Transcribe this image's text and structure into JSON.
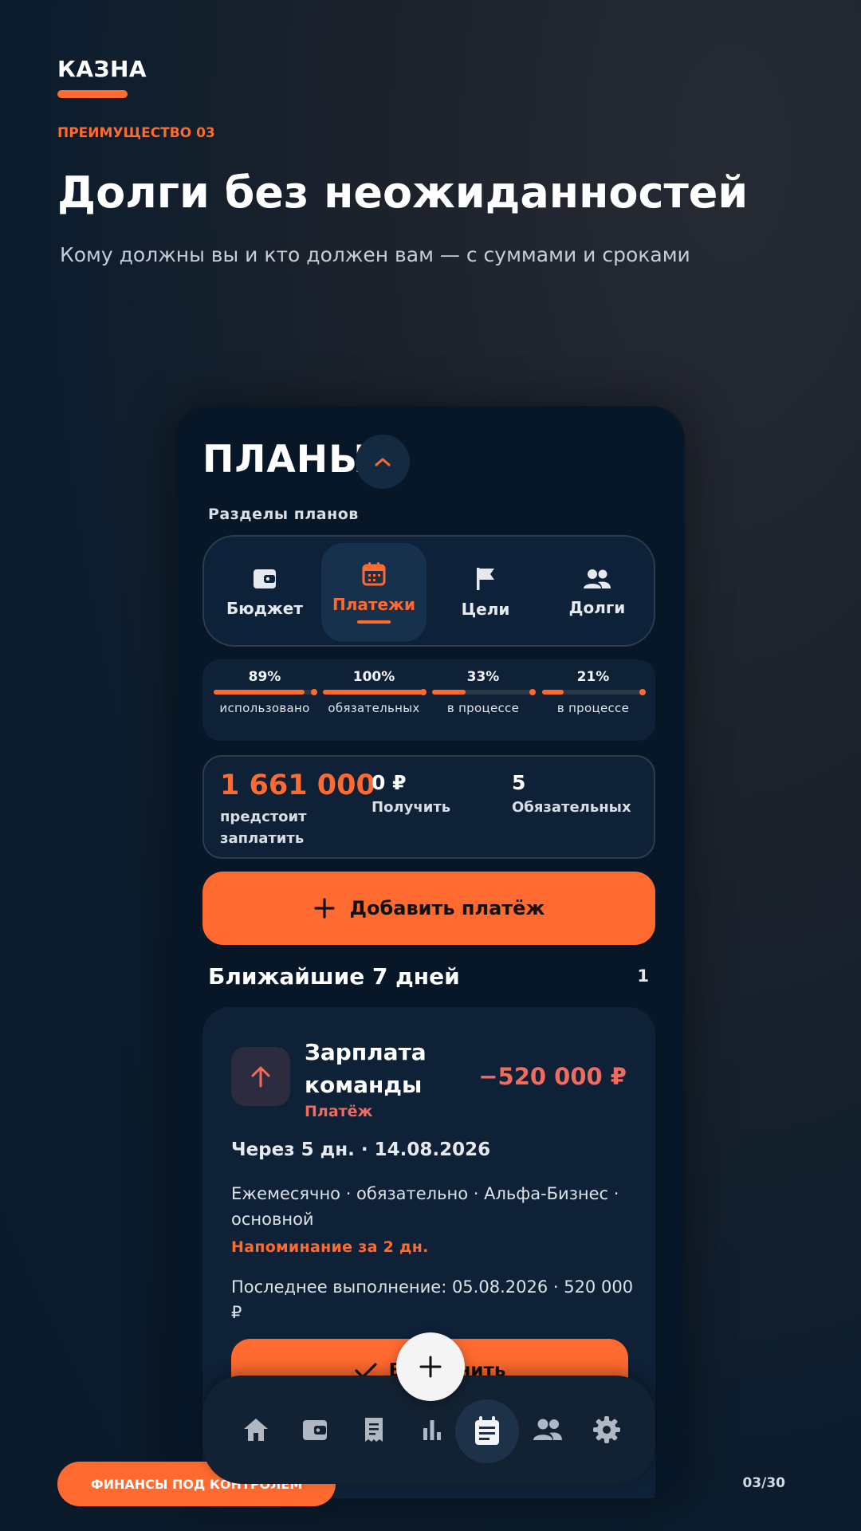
{
  "brand": "КАЗНА",
  "kicker": "ПРЕИМУЩЕСТВО 03",
  "headline": "Долги без неожиданностей",
  "subheadline": "Кому должны вы и кто должен вам — с суммами и сроками",
  "app": {
    "title": "ПЛАНЫ",
    "sections_label": "Разделы планов",
    "tabs": [
      {
        "label": "Бюджет",
        "icon": "wallet-icon"
      },
      {
        "label": "Платежи",
        "icon": "calendar-icon",
        "active": true
      },
      {
        "label": "Цели",
        "icon": "flag-icon"
      },
      {
        "label": "Долги",
        "icon": "people-icon"
      }
    ],
    "progress": [
      {
        "percent": "89%",
        "value": 0.89,
        "caption": "использовано"
      },
      {
        "percent": "100%",
        "value": 1.0,
        "caption": "обязательных"
      },
      {
        "percent": "33%",
        "value": 0.33,
        "caption": "в процессе"
      },
      {
        "percent": "21%",
        "value": 0.21,
        "caption": "в процессе"
      }
    ],
    "stats": {
      "main_value": "1 661 000",
      "main_caption": "предстоит заплатить",
      "receive_value": "0 ₽",
      "receive_caption": "Получить",
      "mandatory_value": "5",
      "mandatory_caption": "Обязательных"
    },
    "add_button": "Добавить платёж",
    "upcoming": {
      "title": "Ближайшие 7 дней",
      "count": "1"
    },
    "payment": {
      "title": "Зарплата команды",
      "kind": "Платёж",
      "amount": "−520 000 ₽",
      "when": "Через 5 дн. · 14.08.2026",
      "details": "Ежемесячно · обязательно · Альфа-Бизнес · основной",
      "reminder": "Напоминание за 2 дн.",
      "last": "Последнее выполнение: 05.08.2026 · 520 000 ₽",
      "done_button": "Выполнить"
    },
    "bottom_nav": [
      "home-icon",
      "wallet-icon",
      "receipt-icon",
      "chart-icon",
      "plans-icon",
      "people-icon",
      "settings-icon"
    ]
  },
  "footer": {
    "tagline": "ФИНАНСЫ ПОД КОНТРОЛЕМ",
    "page": "03/30"
  },
  "colors": {
    "accent": "#ff6a30",
    "negative": "#f26b5f",
    "panel": "#0e2137"
  }
}
